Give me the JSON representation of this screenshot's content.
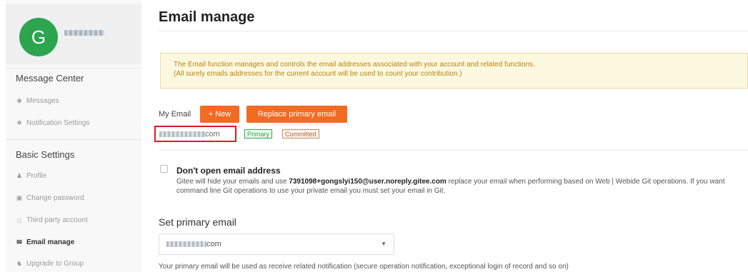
{
  "sidebar": {
    "avatar_letter": "G",
    "sections": [
      {
        "heading": "Message Center",
        "items": [
          {
            "label": "Messages",
            "icon": "bell-icon"
          },
          {
            "label": "Notification Settings",
            "icon": "broadcast-icon"
          }
        ]
      },
      {
        "heading": "Basic Settings",
        "items": [
          {
            "label": "Profile",
            "icon": "user-icon"
          },
          {
            "label": "Change password",
            "icon": "lock-icon"
          },
          {
            "label": "Third party account",
            "icon": "link-icon"
          },
          {
            "label": "Email manage",
            "icon": "envelope-icon",
            "active": true
          },
          {
            "label": "Upgrade to Group",
            "icon": "group-icon"
          }
        ]
      }
    ]
  },
  "main": {
    "title": "Email manage",
    "notice": {
      "line1": "The Email function manages and controls the email addresses associated with your account and related functions.",
      "line2": "(All surely emails addresses for the current account will be used to count your contribution.)"
    },
    "my_email_label": "My Email",
    "new_button": "+ New",
    "replace_button": "Replace primary email",
    "email_suffix": "com",
    "badges": {
      "primary": "Primary",
      "committed": "Committed"
    },
    "dont_open": {
      "title": "Don't open email address",
      "desc_before": "Gitee will hide your emails and use ",
      "noreply": "7391098+gongslyi150@user.noreply.gitee.com",
      "desc_after": " replace your email when performing based on Web | Webide Git operations. If you want command line Git operations to use your private email you must set your email in Git."
    },
    "set_primary": {
      "title": "Set primary email",
      "selected_suffix": "com",
      "hint": "Your primary email will be used as receive related notification (secure operation notification, exceptional login of record and so on)"
    }
  },
  "colors": {
    "accent": "#f26b22",
    "avatar": "#2da44e",
    "highlight": "#e0182a"
  }
}
